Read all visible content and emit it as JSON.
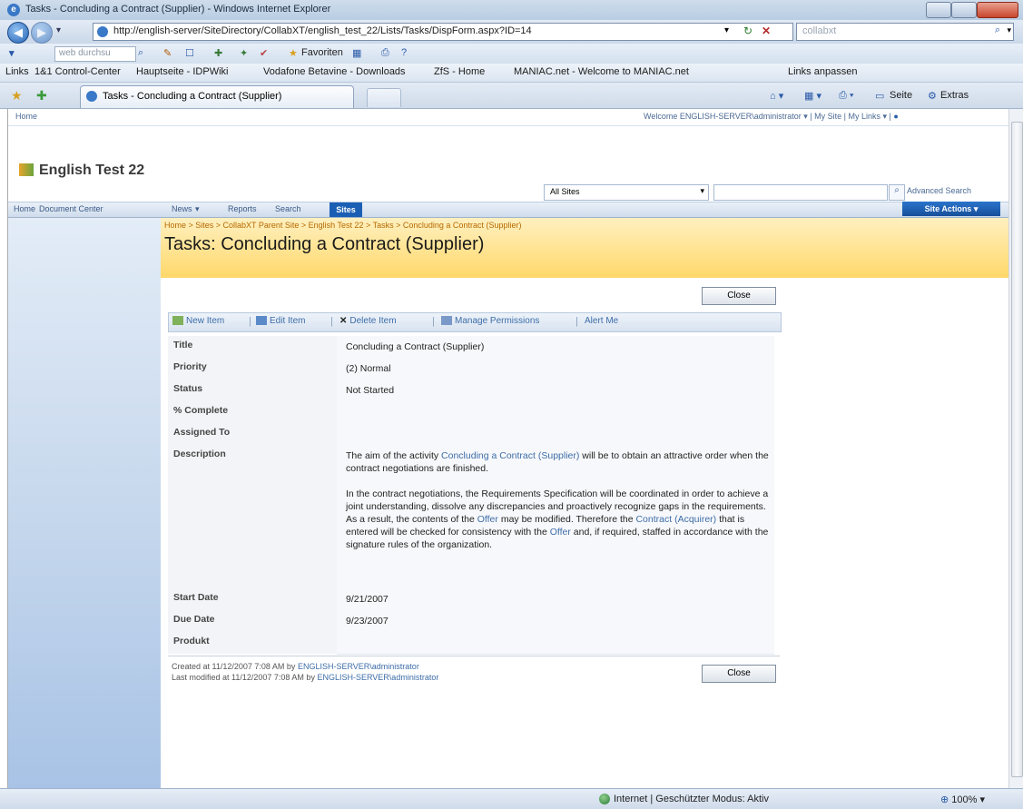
{
  "window": {
    "title": "Tasks - Concluding a Contract (Supplier) - Windows Internet Explorer",
    "url": "http://english-server/SiteDirectory/CollabXT/english_test_22/Lists/Tasks/DispForm.aspx?ID=14",
    "search_value": "collabxt"
  },
  "toolbar": {
    "web_search": "web durchsu",
    "favorites": "Favoriten"
  },
  "links_bar": {
    "label": "Links",
    "items": [
      "1&1 Control-Center",
      "Hauptseite - IDPWiki",
      "Vodafone Betavine - Downloads",
      "ZfS - Home",
      "MANIAC.net - Welcome to MANIAC.net",
      "Links anpassen"
    ]
  },
  "tab": {
    "title": "Tasks - Concluding a Contract (Supplier)"
  },
  "command_bar": {
    "page": "Seite",
    "extras": "Extras"
  },
  "sharepoint": {
    "top_home": "Home",
    "welcome": "Welcome ENGLISH-SERVER\\administrator",
    "my_site": "My Site",
    "my_links": "My Links",
    "site_title": "English Test 22",
    "search_scope": "All Sites",
    "advanced_search": "Advanced Search",
    "nav": [
      "Home",
      "Document Center",
      "News",
      "Reports",
      "Search",
      "Sites"
    ],
    "site_actions": "Site Actions",
    "breadcrumb": "Home > Sites > CollabXT Parent Site > English Test 22 > Tasks > Concluding a Contract (Supplier)",
    "page_title": "Tasks: Concluding a Contract (Supplier)",
    "close": "Close",
    "list_toolbar": [
      "New Item",
      "Edit Item",
      "Delete Item",
      "Manage Permissions",
      "Alert Me"
    ],
    "fields": {
      "title_label": "Title",
      "title_value": "Concluding a Contract (Supplier)",
      "priority_label": "Priority",
      "priority_value": "(2) Normal",
      "status_label": "Status",
      "status_value": "Not Started",
      "complete_label": "% Complete",
      "assigned_label": "Assigned To",
      "description_label": "Description",
      "desc_p1_a": "The aim of the activity ",
      "desc_p1_link": "Concluding a Contract (Supplier)",
      "desc_p1_b": " will be to obtain an attractive order when the contract negotiations are finished.",
      "desc_p2_a": "In the contract negotiations, the Requirements Specification will be coordinated in order to achieve a joint understanding, dissolve any discrepancies and proactively recognize gaps in the requirements. As a result, the contents of the ",
      "desc_p2_offer": "Offer",
      "desc_p2_b": " may be modified. Therefore the ",
      "desc_p2_contract": "Contract (Acquirer)",
      "desc_p2_c": " that is entered will be checked for consistency with the ",
      "desc_p2_offer2": "Offer",
      "desc_p2_d": " and, if required, staffed in accordance with the signature rules of the organization.",
      "start_label": "Start Date",
      "start_value": "9/21/2007",
      "due_label": "Due Date",
      "due_value": "9/23/2007",
      "produkt_label": "Produkt"
    },
    "created_text": "Created at 11/12/2007 7:08 AM  by ",
    "created_by": "ENGLISH-SERVER\\administrator",
    "modified_text": "Last modified at 11/12/2007 7:08 AM  by ",
    "modified_by": "ENGLISH-SERVER\\administrator"
  },
  "status": {
    "zone": "Internet | Geschützter Modus: Aktiv",
    "zoom": "100%"
  }
}
